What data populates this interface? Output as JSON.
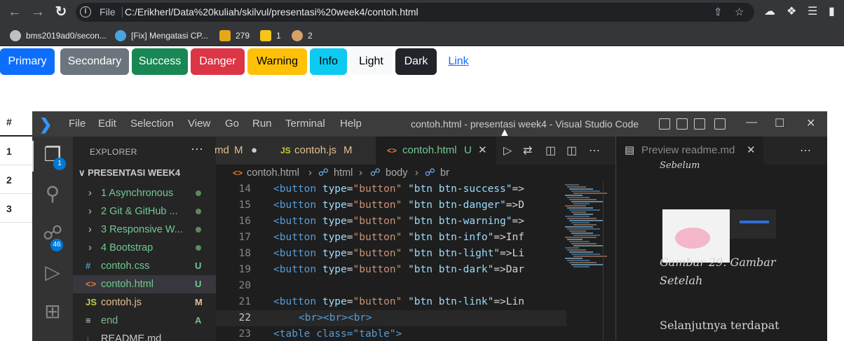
{
  "browser": {
    "address_scheme": "File",
    "url": "C:/Erikherl/Data%20kuliah/skilvul/presentasi%20week4/contoh.html",
    "bookmarks": [
      {
        "label": "bms2019ad0/secon..."
      },
      {
        "label": "[Fix] Mengatasi CP..."
      },
      {
        "label": "279"
      },
      {
        "label": "1"
      },
      {
        "label": "2"
      }
    ]
  },
  "page": {
    "buttons": [
      {
        "label": "Primary",
        "bg": "#0d6efd",
        "fg": "#ffffff"
      },
      {
        "label": "Secondary",
        "bg": "#6c757d",
        "fg": "#ffffff"
      },
      {
        "label": "Success",
        "bg": "#198754",
        "fg": "#ffffff"
      },
      {
        "label": "Danger",
        "bg": "#dc3545",
        "fg": "#ffffff"
      },
      {
        "label": "Warning",
        "bg": "#ffc107",
        "fg": "#000000"
      },
      {
        "label": "Info",
        "bg": "#0dcaf0",
        "fg": "#000000"
      },
      {
        "label": "Light",
        "bg": "#f8f9fa",
        "fg": "#000000"
      },
      {
        "label": "Dark",
        "bg": "#212529",
        "fg": "#ffffff"
      },
      {
        "label": "Link",
        "bg": "transparent",
        "fg": "#0d6efd"
      }
    ],
    "table": {
      "header": "#",
      "rows": [
        "1",
        "2",
        "3"
      ]
    }
  },
  "vscode": {
    "menu": [
      "File",
      "Edit",
      "Selection",
      "View",
      "Go",
      "Run",
      "Terminal",
      "Help"
    ],
    "title": "contoh.html - presentasi week4 - Visual Studio Code",
    "activity_badges": {
      "explorer": "1",
      "scm": "46"
    },
    "explorer": {
      "title": "EXPLORER",
      "folder": "PRESENTASI WEEK4",
      "items": [
        {
          "label": "1 Asynchronous",
          "type": "folder",
          "status": ""
        },
        {
          "label": "2 Git & GitHub ...",
          "type": "folder",
          "status": ""
        },
        {
          "label": "3 Responsive W...",
          "type": "folder",
          "status": ""
        },
        {
          "label": "4 Bootstrap",
          "type": "folder",
          "status": ""
        },
        {
          "label": "contoh.css",
          "type": "css",
          "status": "U"
        },
        {
          "label": "contoh.html",
          "type": "html",
          "status": "U"
        },
        {
          "label": "contoh.js",
          "type": "js",
          "status": "M"
        },
        {
          "label": "end",
          "type": "text",
          "status": "A"
        },
        {
          "label": "README.md",
          "type": "md",
          "status": ""
        }
      ]
    },
    "tabs": [
      {
        "label": "md",
        "status": "M"
      },
      {
        "label": "contoh.js",
        "status": "M"
      },
      {
        "label": "contoh.html",
        "status": "U"
      }
    ],
    "breadcrumb": [
      "contoh.html",
      "html",
      "body",
      "br"
    ],
    "code_lines": [
      {
        "n": "14",
        "cls": "btn btn-success",
        "rest": ">"
      },
      {
        "n": "15",
        "cls": "btn btn-danger",
        "rest": ">D"
      },
      {
        "n": "16",
        "cls": "btn btn-warning",
        "rest": ">"
      },
      {
        "n": "17",
        "cls": "btn btn-info",
        "rest": ">Inf"
      },
      {
        "n": "18",
        "cls": "btn btn-light",
        "rest": ">Li"
      },
      {
        "n": "19",
        "cls": "btn btn-dark",
        "rest": ">Dar"
      },
      {
        "n": "20",
        "cls": "",
        "rest": ""
      },
      {
        "n": "21",
        "cls": "btn btn-link",
        "rest": ">Lin"
      },
      {
        "n": "22",
        "cls": "",
        "rest": ""
      },
      {
        "n": "23",
        "cls": "",
        "rest": ""
      }
    ],
    "line22_text": "<br><br><br>",
    "line23_text": "<table class=\"table\">",
    "preview": {
      "tab_label": "Preview readme.md",
      "top_text": "Sebelum",
      "caption_line1": "Gambar 29. Gambar",
      "caption_line2": "Setelah",
      "para": "Selanjutnya terdapat"
    }
  }
}
